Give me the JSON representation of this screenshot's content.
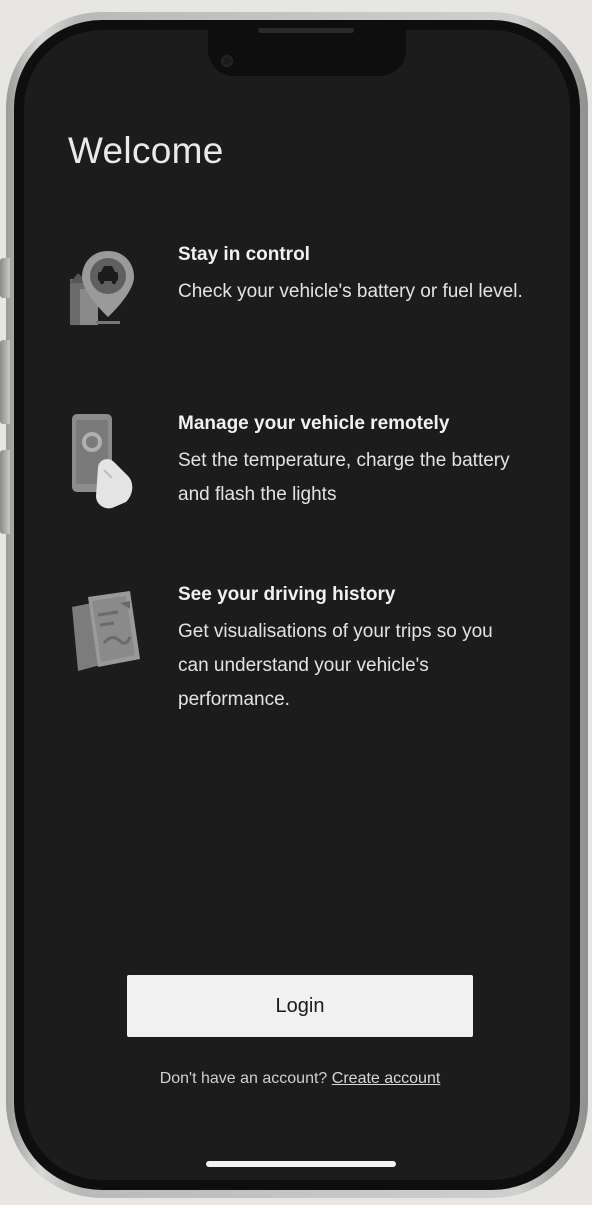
{
  "screen": {
    "title": "Welcome"
  },
  "features": [
    {
      "title": "Stay in control",
      "description": "Check your vehicle's battery or fuel level.",
      "icon": "map-pin-car-icon"
    },
    {
      "title": "Manage your vehicle remotely",
      "description": "Set the temperature, charge the battery and flash the lights",
      "icon": "phone-hand-icon"
    },
    {
      "title": "See your driving history",
      "description": "Get visualisations of your trips so you can understand your vehicle's performance.",
      "icon": "trip-map-icon"
    }
  ],
  "login": {
    "label": "Login"
  },
  "signup": {
    "prompt": "Don't have an account?",
    "link": "Create account"
  },
  "colors": {
    "screen_background": "#1c1c1c",
    "button_background": "#f1f1f1",
    "text_primary": "#f1f1f1"
  }
}
